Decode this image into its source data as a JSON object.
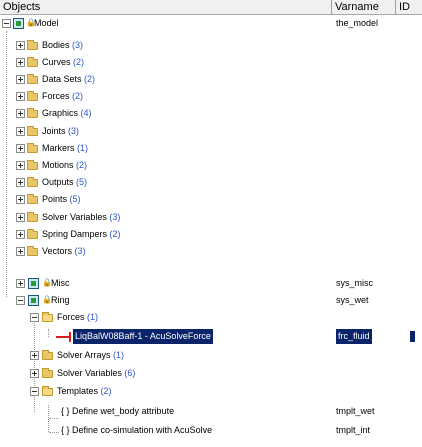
{
  "header": {
    "objects": "Objects",
    "varname": "Varname",
    "id": "ID"
  },
  "model": {
    "label": "Model",
    "varname": "the_model"
  },
  "top_items": [
    {
      "label": "Bodies",
      "count": "(3)"
    },
    {
      "label": "Curves",
      "count": "(2)"
    },
    {
      "label": "Data Sets",
      "count": "(2)"
    },
    {
      "label": "Forces",
      "count": "(2)"
    },
    {
      "label": "Graphics",
      "count": "(4)"
    },
    {
      "label": "Joints",
      "count": "(3)"
    },
    {
      "label": "Markers",
      "count": "(1)"
    },
    {
      "label": "Motions",
      "count": "(2)"
    },
    {
      "label": "Outputs",
      "count": "(5)"
    },
    {
      "label": "Points",
      "count": "(5)"
    },
    {
      "label": "Solver Variables",
      "count": "(3)"
    },
    {
      "label": "Spring Dampers",
      "count": "(2)"
    },
    {
      "label": "Vectors",
      "count": "(3)"
    }
  ],
  "misc": {
    "label": "Misc",
    "varname": "sys_misc"
  },
  "ring": {
    "label": "Ring",
    "varname": "sys_wet"
  },
  "ring_forces": {
    "label": "Forces",
    "count": "(1)"
  },
  "selected_force": {
    "label": "LiqBalW08Baff-1 - AcuSolveForce",
    "varname": "frc_fluid"
  },
  "solver_arrays": {
    "label": "Solver Arrays",
    "count": "(1)"
  },
  "ring_solver_vars": {
    "label": "Solver Variables",
    "count": "(6)"
  },
  "templates": {
    "label": "Templates",
    "count": "(2)"
  },
  "template_items": [
    {
      "label": "{ } Define wet_body attribute",
      "varname": "tmplt_wet"
    },
    {
      "label": "{ } Define co-simulation with AcuSolve",
      "varname": "tmplt_int"
    }
  ]
}
